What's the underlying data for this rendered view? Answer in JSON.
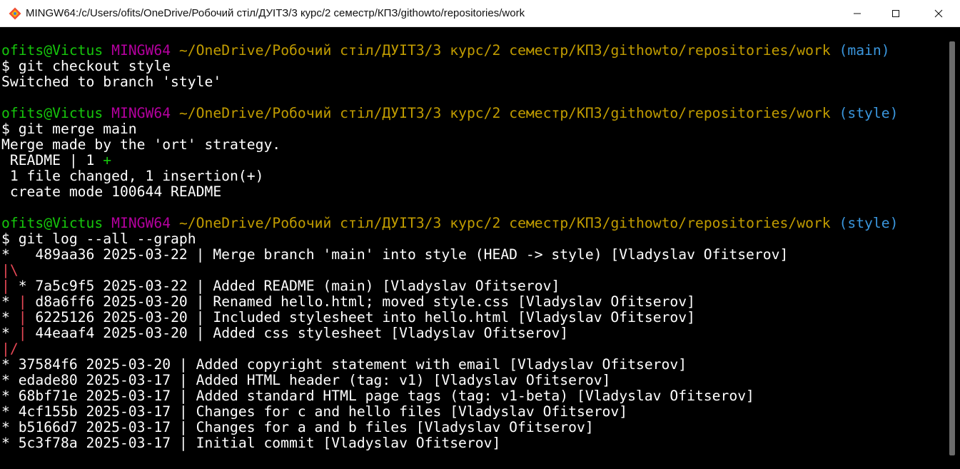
{
  "window": {
    "title": "MINGW64:/c/Users/ofits/OneDrive/Робочий стіл/ДУІТЗ/3 курс/2 семестр/КПЗ/githowto/repositories/work"
  },
  "colors": {
    "user": "#16c60c",
    "host": "#b4009e",
    "path": "#c19c00",
    "branch": "#3a96dd",
    "text": "#ffffff",
    "graph": "#e74856",
    "plus": "#16c60c"
  },
  "terminal": {
    "lines": [
      {
        "spans": [
          {
            "t": "ofits@Victus",
            "c": "user"
          },
          {
            "t": " ",
            "c": "text"
          },
          {
            "t": "MINGW64",
            "c": "host"
          },
          {
            "t": " ",
            "c": "text"
          },
          {
            "t": "~/OneDrive/Робочий стіл/ДУІТЗ/3 курс/2 семестр/КПЗ/githowto/repositories/work",
            "c": "path"
          },
          {
            "t": " ",
            "c": "text"
          },
          {
            "t": "(main)",
            "c": "branch"
          }
        ]
      },
      {
        "spans": [
          {
            "t": "$ git checkout style",
            "c": "text"
          }
        ]
      },
      {
        "spans": [
          {
            "t": "Switched to branch 'style'",
            "c": "text"
          }
        ]
      },
      {
        "spans": []
      },
      {
        "spans": [
          {
            "t": "ofits@Victus",
            "c": "user"
          },
          {
            "t": " ",
            "c": "text"
          },
          {
            "t": "MINGW64",
            "c": "host"
          },
          {
            "t": " ",
            "c": "text"
          },
          {
            "t": "~/OneDrive/Робочий стіл/ДУІТЗ/3 курс/2 семестр/КПЗ/githowto/repositories/work",
            "c": "path"
          },
          {
            "t": " ",
            "c": "text"
          },
          {
            "t": "(style)",
            "c": "branch"
          }
        ]
      },
      {
        "spans": [
          {
            "t": "$ git merge main",
            "c": "text"
          }
        ]
      },
      {
        "spans": [
          {
            "t": "Merge made by the 'ort' strategy.",
            "c": "text"
          }
        ]
      },
      {
        "spans": [
          {
            "t": " README | 1 ",
            "c": "text"
          },
          {
            "t": "+",
            "c": "plus"
          }
        ]
      },
      {
        "spans": [
          {
            "t": " 1 file changed, 1 insertion(+)",
            "c": "text"
          }
        ]
      },
      {
        "spans": [
          {
            "t": " create mode 100644 README",
            "c": "text"
          }
        ]
      },
      {
        "spans": []
      },
      {
        "spans": [
          {
            "t": "ofits@Victus",
            "c": "user"
          },
          {
            "t": " ",
            "c": "text"
          },
          {
            "t": "MINGW64",
            "c": "host"
          },
          {
            "t": " ",
            "c": "text"
          },
          {
            "t": "~/OneDrive/Робочий стіл/ДУІТЗ/3 курс/2 семестр/КПЗ/githowto/repositories/work",
            "c": "path"
          },
          {
            "t": " ",
            "c": "text"
          },
          {
            "t": "(style)",
            "c": "branch"
          }
        ]
      },
      {
        "spans": [
          {
            "t": "$ git log --all --graph",
            "c": "text"
          }
        ]
      },
      {
        "spans": [
          {
            "t": "*   489aa36 2025-03-22 | Merge branch 'main' into style (HEAD -> style) [Vladyslav Ofitserov]",
            "c": "text"
          }
        ]
      },
      {
        "spans": [
          {
            "t": "|\\",
            "c": "graph"
          }
        ]
      },
      {
        "spans": [
          {
            "t": "|",
            "c": "graph"
          },
          {
            "t": " * 7a5c9f5 2025-03-22 | Added README (main) [Vladyslav Ofitserov]",
            "c": "text"
          }
        ]
      },
      {
        "spans": [
          {
            "t": "* ",
            "c": "text"
          },
          {
            "t": "|",
            "c": "graph"
          },
          {
            "t": " d8a6ff6 2025-03-20 | Renamed hello.html; moved style.css [Vladyslav Ofitserov]",
            "c": "text"
          }
        ]
      },
      {
        "spans": [
          {
            "t": "* ",
            "c": "text"
          },
          {
            "t": "|",
            "c": "graph"
          },
          {
            "t": " 6225126 2025-03-20 | Included stylesheet into hello.html [Vladyslav Ofitserov]",
            "c": "text"
          }
        ]
      },
      {
        "spans": [
          {
            "t": "* ",
            "c": "text"
          },
          {
            "t": "|",
            "c": "graph"
          },
          {
            "t": " 44eaaf4 2025-03-20 | Added css stylesheet [Vladyslav Ofitserov]",
            "c": "text"
          }
        ]
      },
      {
        "spans": [
          {
            "t": "|/",
            "c": "graph"
          }
        ]
      },
      {
        "spans": [
          {
            "t": "* 37584f6 2025-03-20 | Added copyright statement with email [Vladyslav Ofitserov]",
            "c": "text"
          }
        ]
      },
      {
        "spans": [
          {
            "t": "* edade80 2025-03-17 | Added HTML header (tag: v1) [Vladyslav Ofitserov]",
            "c": "text"
          }
        ]
      },
      {
        "spans": [
          {
            "t": "* 68bf71e 2025-03-17 | Added standard HTML page tags (tag: v1-beta) [Vladyslav Ofitserov]",
            "c": "text"
          }
        ]
      },
      {
        "spans": [
          {
            "t": "* 4cf155b 2025-03-17 | Changes for c and hello files [Vladyslav Ofitserov]",
            "c": "text"
          }
        ]
      },
      {
        "spans": [
          {
            "t": "* b5166d7 2025-03-17 | Changes for a and b files [Vladyslav Ofitserov]",
            "c": "text"
          }
        ]
      },
      {
        "spans": [
          {
            "t": "* 5c3f78a 2025-03-17 | Initial commit [Vladyslav Ofitserov]",
            "c": "text"
          }
        ]
      }
    ]
  }
}
